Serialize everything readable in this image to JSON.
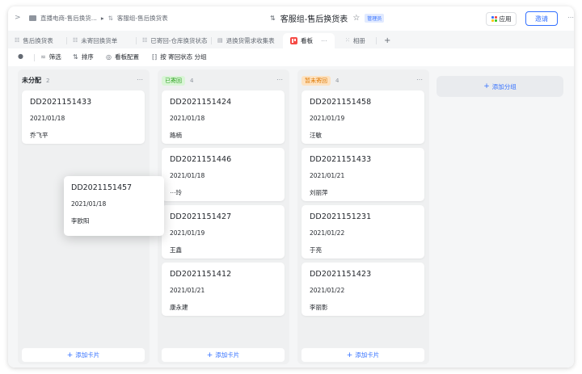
{
  "topbar": {
    "breadcrumb": [
      "直播电商-售后换货...",
      "客服组-售后换货表"
    ],
    "doc_title": "客服组-售后换货表",
    "admin_badge": "管理员",
    "apps_label": "应用",
    "invite_label": "邀请",
    "apps_dot_colors": [
      "#3370ff",
      "#f54a45",
      "#ffc60a",
      "#34c724"
    ]
  },
  "tabs": [
    {
      "label": "售后换货表"
    },
    {
      "label": "未寄回换货单"
    },
    {
      "label": "已寄回-仓库换货状态"
    },
    {
      "label": "退换货需求收集表"
    },
    {
      "label": "看板",
      "active": true
    },
    {
      "label": "相册"
    }
  ],
  "toolbar": {
    "filter_label": "筛选",
    "sort_label": "排序",
    "config_label": "看板配置",
    "group_label": "按 寄回状态 分组"
  },
  "colors": {
    "accent": "#3370ff",
    "returned_tag_bg": "#d9f5d6",
    "returned_tag_fg": "#2ea121",
    "not_returned_tag_bg": "#fde2c1",
    "not_returned_tag_fg": "#de7802"
  },
  "columns": [
    {
      "title": "未分配",
      "count": "2",
      "tag": false,
      "add_label": "添加卡片",
      "cards": [
        {
          "id": "DD2021151433",
          "date": "2021/01/18",
          "name": "乔飞平"
        }
      ]
    },
    {
      "title": "已寄回",
      "count": "4",
      "tag": true,
      "add_label": "添加卡片",
      "cards": [
        {
          "id": "DD2021151424",
          "date": "2021/01/18",
          "name": "路楠"
        },
        {
          "id": "DD2021151446",
          "date": "2021/01/18",
          "name": "⋯玲"
        },
        {
          "id": "DD2021151427",
          "date": "2021/01/19",
          "name": "王鑫"
        },
        {
          "id": "DD2021151412",
          "date": "2021/01/21",
          "name": "康永建"
        }
      ]
    },
    {
      "title": "暂未寄回",
      "count": "4",
      "tag": true,
      "add_label": "添加卡片",
      "cards": [
        {
          "id": "DD2021151458",
          "date": "2021/01/19",
          "name": "汪敏"
        },
        {
          "id": "DD2021151433",
          "date": "2021/01/21",
          "name": "刘丽萍"
        },
        {
          "id": "DD2021151231",
          "date": "2021/01/22",
          "name": "于亮"
        },
        {
          "id": "DD2021151423",
          "date": "2021/01/22",
          "name": "李丽影"
        }
      ]
    }
  ],
  "add_group_label": "添加分组",
  "dragging_card": {
    "id": "DD2021151457",
    "date": "2021/01/18",
    "name": "李欧阳"
  }
}
